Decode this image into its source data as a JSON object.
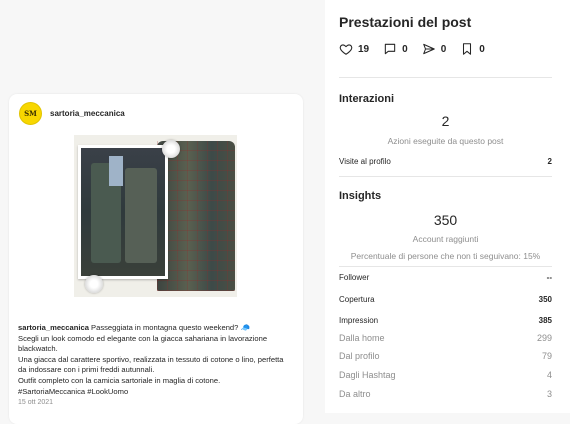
{
  "post": {
    "username": "sartoria_meccanica",
    "avatar_text": "SM",
    "caption_lines": [
      {
        "user": "sartoria_meccanica",
        "text": " Passeggiata in montagna questo weekend? 🧢"
      },
      {
        "text": "Scegli un look comodo ed elegante con la giacca sahariana in lavorazione"
      },
      {
        "text": "blackwatch."
      },
      {
        "text": "Una giacca dal carattere sportivo, realizzata in tessuto di cotone o lino, perfetta"
      },
      {
        "text": "da indossare con i primi freddi autunnali."
      },
      {
        "text": "Outfit completo con la camicia sartoriale in maglia di cotone."
      },
      {
        "text": "#SartoriaMeccanica #LookUomo"
      }
    ],
    "date": "15 ott 2021"
  },
  "panel": {
    "title": "Prestazioni del post",
    "metrics": [
      {
        "icon": "heart-icon",
        "value": "19"
      },
      {
        "icon": "comment-icon",
        "value": "0"
      },
      {
        "icon": "share-icon",
        "value": "0"
      },
      {
        "icon": "bookmark-icon",
        "value": "0"
      }
    ],
    "interactions": {
      "title": "Interazioni",
      "count": "2",
      "subtitle": "Azioni eseguite da questo post",
      "profile_visits_label": "Visite al profilo",
      "profile_visits_value": "2"
    },
    "insights": {
      "title": "Insights",
      "reach": "350",
      "reach_label": "Account raggiunti",
      "non_followers": "Percentuale di persone che non ti seguivano: 15%",
      "rows": [
        {
          "label": "Follower",
          "value": "--",
          "style": "bold"
        },
        {
          "label": "Copertura",
          "value": "350",
          "style": "bold"
        },
        {
          "label": "Impression",
          "value": "385",
          "style": "bold"
        },
        {
          "label": "Dalla home",
          "value": "299",
          "style": "light"
        },
        {
          "label": "Dal profilo",
          "value": "79",
          "style": "light"
        },
        {
          "label": "Dagli Hashtag",
          "value": "4",
          "style": "light"
        },
        {
          "label": "Da altro",
          "value": "3",
          "style": "light"
        }
      ]
    }
  }
}
